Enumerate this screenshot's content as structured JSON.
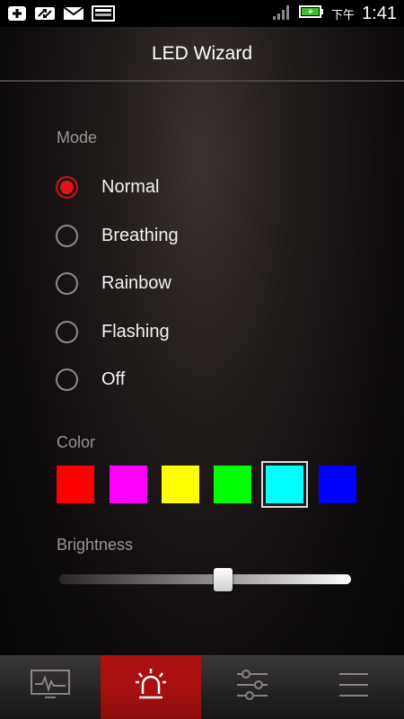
{
  "status_bar": {
    "left_icons": [
      "add-box-icon",
      "swap-icon",
      "mail-icon",
      "keyboard-icon"
    ],
    "signal_icon": "signal-icon",
    "battery_icon": "battery-charging-icon",
    "ampm": "下午",
    "time": "1:41"
  },
  "header": {
    "title": "LED Wizard"
  },
  "mode": {
    "label": "Mode",
    "options": [
      {
        "label": "Normal",
        "checked": true
      },
      {
        "label": "Breathing",
        "checked": false
      },
      {
        "label": "Rainbow",
        "checked": false
      },
      {
        "label": "Flashing",
        "checked": false
      },
      {
        "label": "Off",
        "checked": false
      }
    ]
  },
  "color": {
    "label": "Color",
    "swatches": [
      "#ff0000",
      "#ff00ff",
      "#ffff00",
      "#00ff00",
      "#00ffff",
      "#0000ff"
    ],
    "selected_index": 4
  },
  "brightness": {
    "label": "Brightness",
    "value_fraction": 0.56
  },
  "bottom_nav": {
    "items": [
      {
        "icon": "monitor-icon",
        "active": false
      },
      {
        "icon": "alarm-light-icon",
        "active": true
      },
      {
        "icon": "sliders-icon",
        "active": false
      },
      {
        "icon": "menu-icon",
        "active": false
      }
    ],
    "active_color": "#a9100f"
  },
  "accent_color": "#e2141b"
}
